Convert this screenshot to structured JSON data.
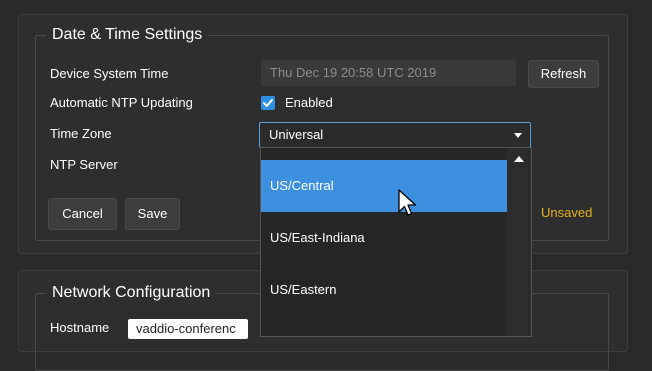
{
  "date_time": {
    "title": "Date & Time Settings",
    "device_time_label": "Device System Time",
    "device_time_value": "Thu Dec 19 20:58 UTC 2019",
    "refresh_label": "Refresh",
    "ntp_updating_label": "Automatic NTP Updating",
    "ntp_enabled": true,
    "ntp_enabled_text": "Enabled",
    "time_zone_label": "Time Zone",
    "time_zone_value": "Universal",
    "time_zone_options": [
      "US/Central",
      "US/East-Indiana",
      "US/Eastern"
    ],
    "highlighted_option": "US/Central",
    "ntp_server_label": "NTP Server",
    "cancel_label": "Cancel",
    "save_label": "Save",
    "status_text": "Unsaved"
  },
  "network": {
    "title": "Network Configuration",
    "hostname_label": "Hostname",
    "hostname_value": "vaddio-conferenc"
  },
  "colors": {
    "accent": "#2f8ee6",
    "highlight": "#3d8fe0",
    "unsaved": "#e3b21e",
    "panel": "#2e2e2e"
  }
}
